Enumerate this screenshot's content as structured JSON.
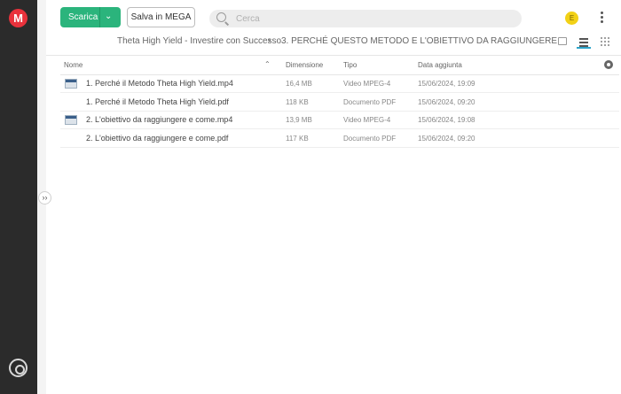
{
  "app": {
    "logo_letter": "M"
  },
  "toolbar": {
    "download_label": "Scarica",
    "save_label": "Salva in MEGA",
    "search_placeholder": "Cerca",
    "avatar_letter": "E"
  },
  "breadcrumb": {
    "parent": "Theta High Yield - Investire con Successo",
    "separator": "›",
    "current": "3. PERCHÉ QUESTO METODO E L'OBIETTIVO DA RAGGIUNGERE"
  },
  "table": {
    "columns": {
      "name": "Nome",
      "size": "Dimensione",
      "type": "Tipo",
      "date": "Data aggiunta"
    },
    "rows": [
      {
        "name": "1. Perché il Metodo Theta High Yield.mp4",
        "size": "16,4 MB",
        "type": "Video MPEG-4",
        "date": "15/06/2024, 19:09",
        "has_thumb": true
      },
      {
        "name": "1. Perché il Metodo Theta High Yield.pdf",
        "size": "118 KB",
        "type": "Documento PDF",
        "date": "15/06/2024, 09:20",
        "has_thumb": false
      },
      {
        "name": "2. L'obiettivo da raggiungere e come.mp4",
        "size": "13,9 MB",
        "type": "Video MPEG-4",
        "date": "15/06/2024, 19:08",
        "has_thumb": true
      },
      {
        "name": "2. L'obiettivo da raggiungere e come.pdf",
        "size": "117 KB",
        "type": "Documento PDF",
        "date": "15/06/2024, 09:20",
        "has_thumb": false
      }
    ]
  },
  "colors": {
    "accent_green": "#2bb47c",
    "brand_red": "#e9323c",
    "rail": "#2b2b2b",
    "avatar": "#f2d116",
    "active_view": "#2ba3c9"
  }
}
